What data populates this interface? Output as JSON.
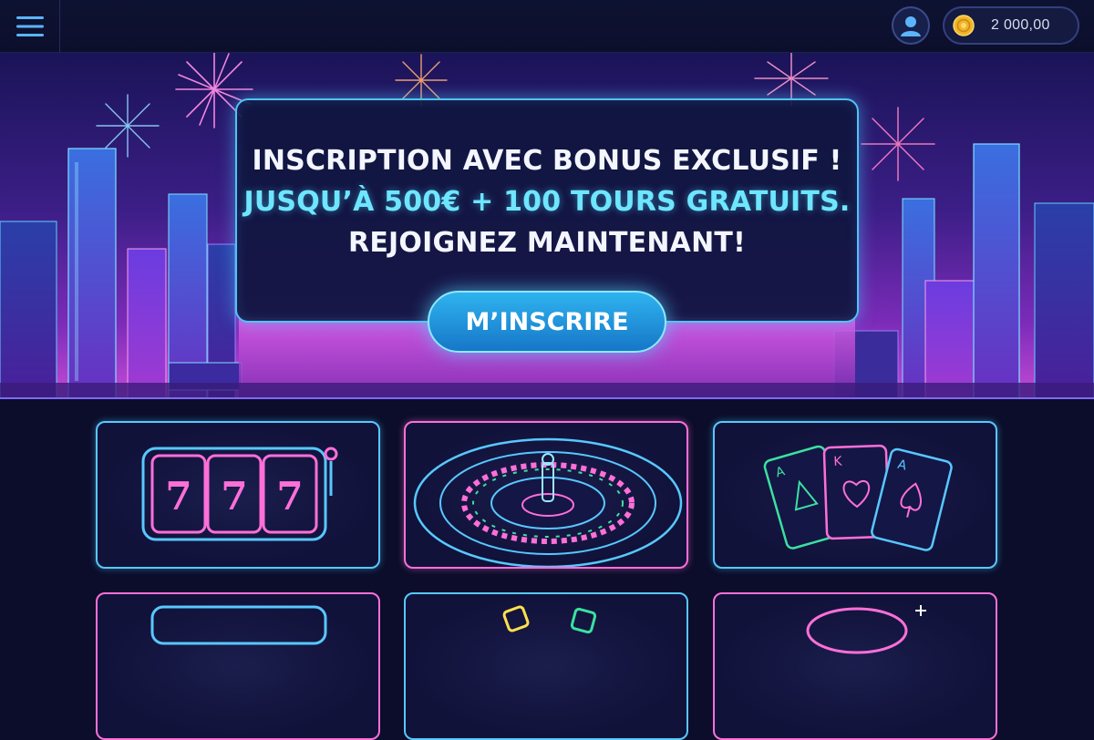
{
  "header": {
    "menu_icon": "hamburger-menu-icon",
    "profile_icon": "user-profile-icon",
    "coin_icon": "gold-coin-icon",
    "balance": "2 000,00"
  },
  "hero": {
    "headline": "INSCRIPTION AVEC BONUS EXCLUSIF !",
    "offer": "JUSQU’À 500€ + 100 TOURS GRATUITS.",
    "call": "REJOIGNEZ MAINTENANT!",
    "cta_label": "M’INSCRIRE",
    "colors": {
      "accent_cyan": "#6ee6ff",
      "button_blue": "#1e90e0",
      "neon_pink": "#ff6fd8"
    }
  },
  "games": [
    {
      "name": "slots-777",
      "icon": "slot-machine-icon",
      "reels": [
        "7",
        "7",
        "7"
      ]
    },
    {
      "name": "roulette",
      "icon": "roulette-wheel-icon"
    },
    {
      "name": "cards",
      "icon": "playing-cards-icon",
      "cards": [
        "A",
        "K",
        "A"
      ]
    },
    {
      "name": "game-4",
      "icon": "game-tile-icon"
    },
    {
      "name": "game-5",
      "icon": "game-tile-icon"
    },
    {
      "name": "game-6",
      "icon": "game-tile-icon"
    }
  ]
}
